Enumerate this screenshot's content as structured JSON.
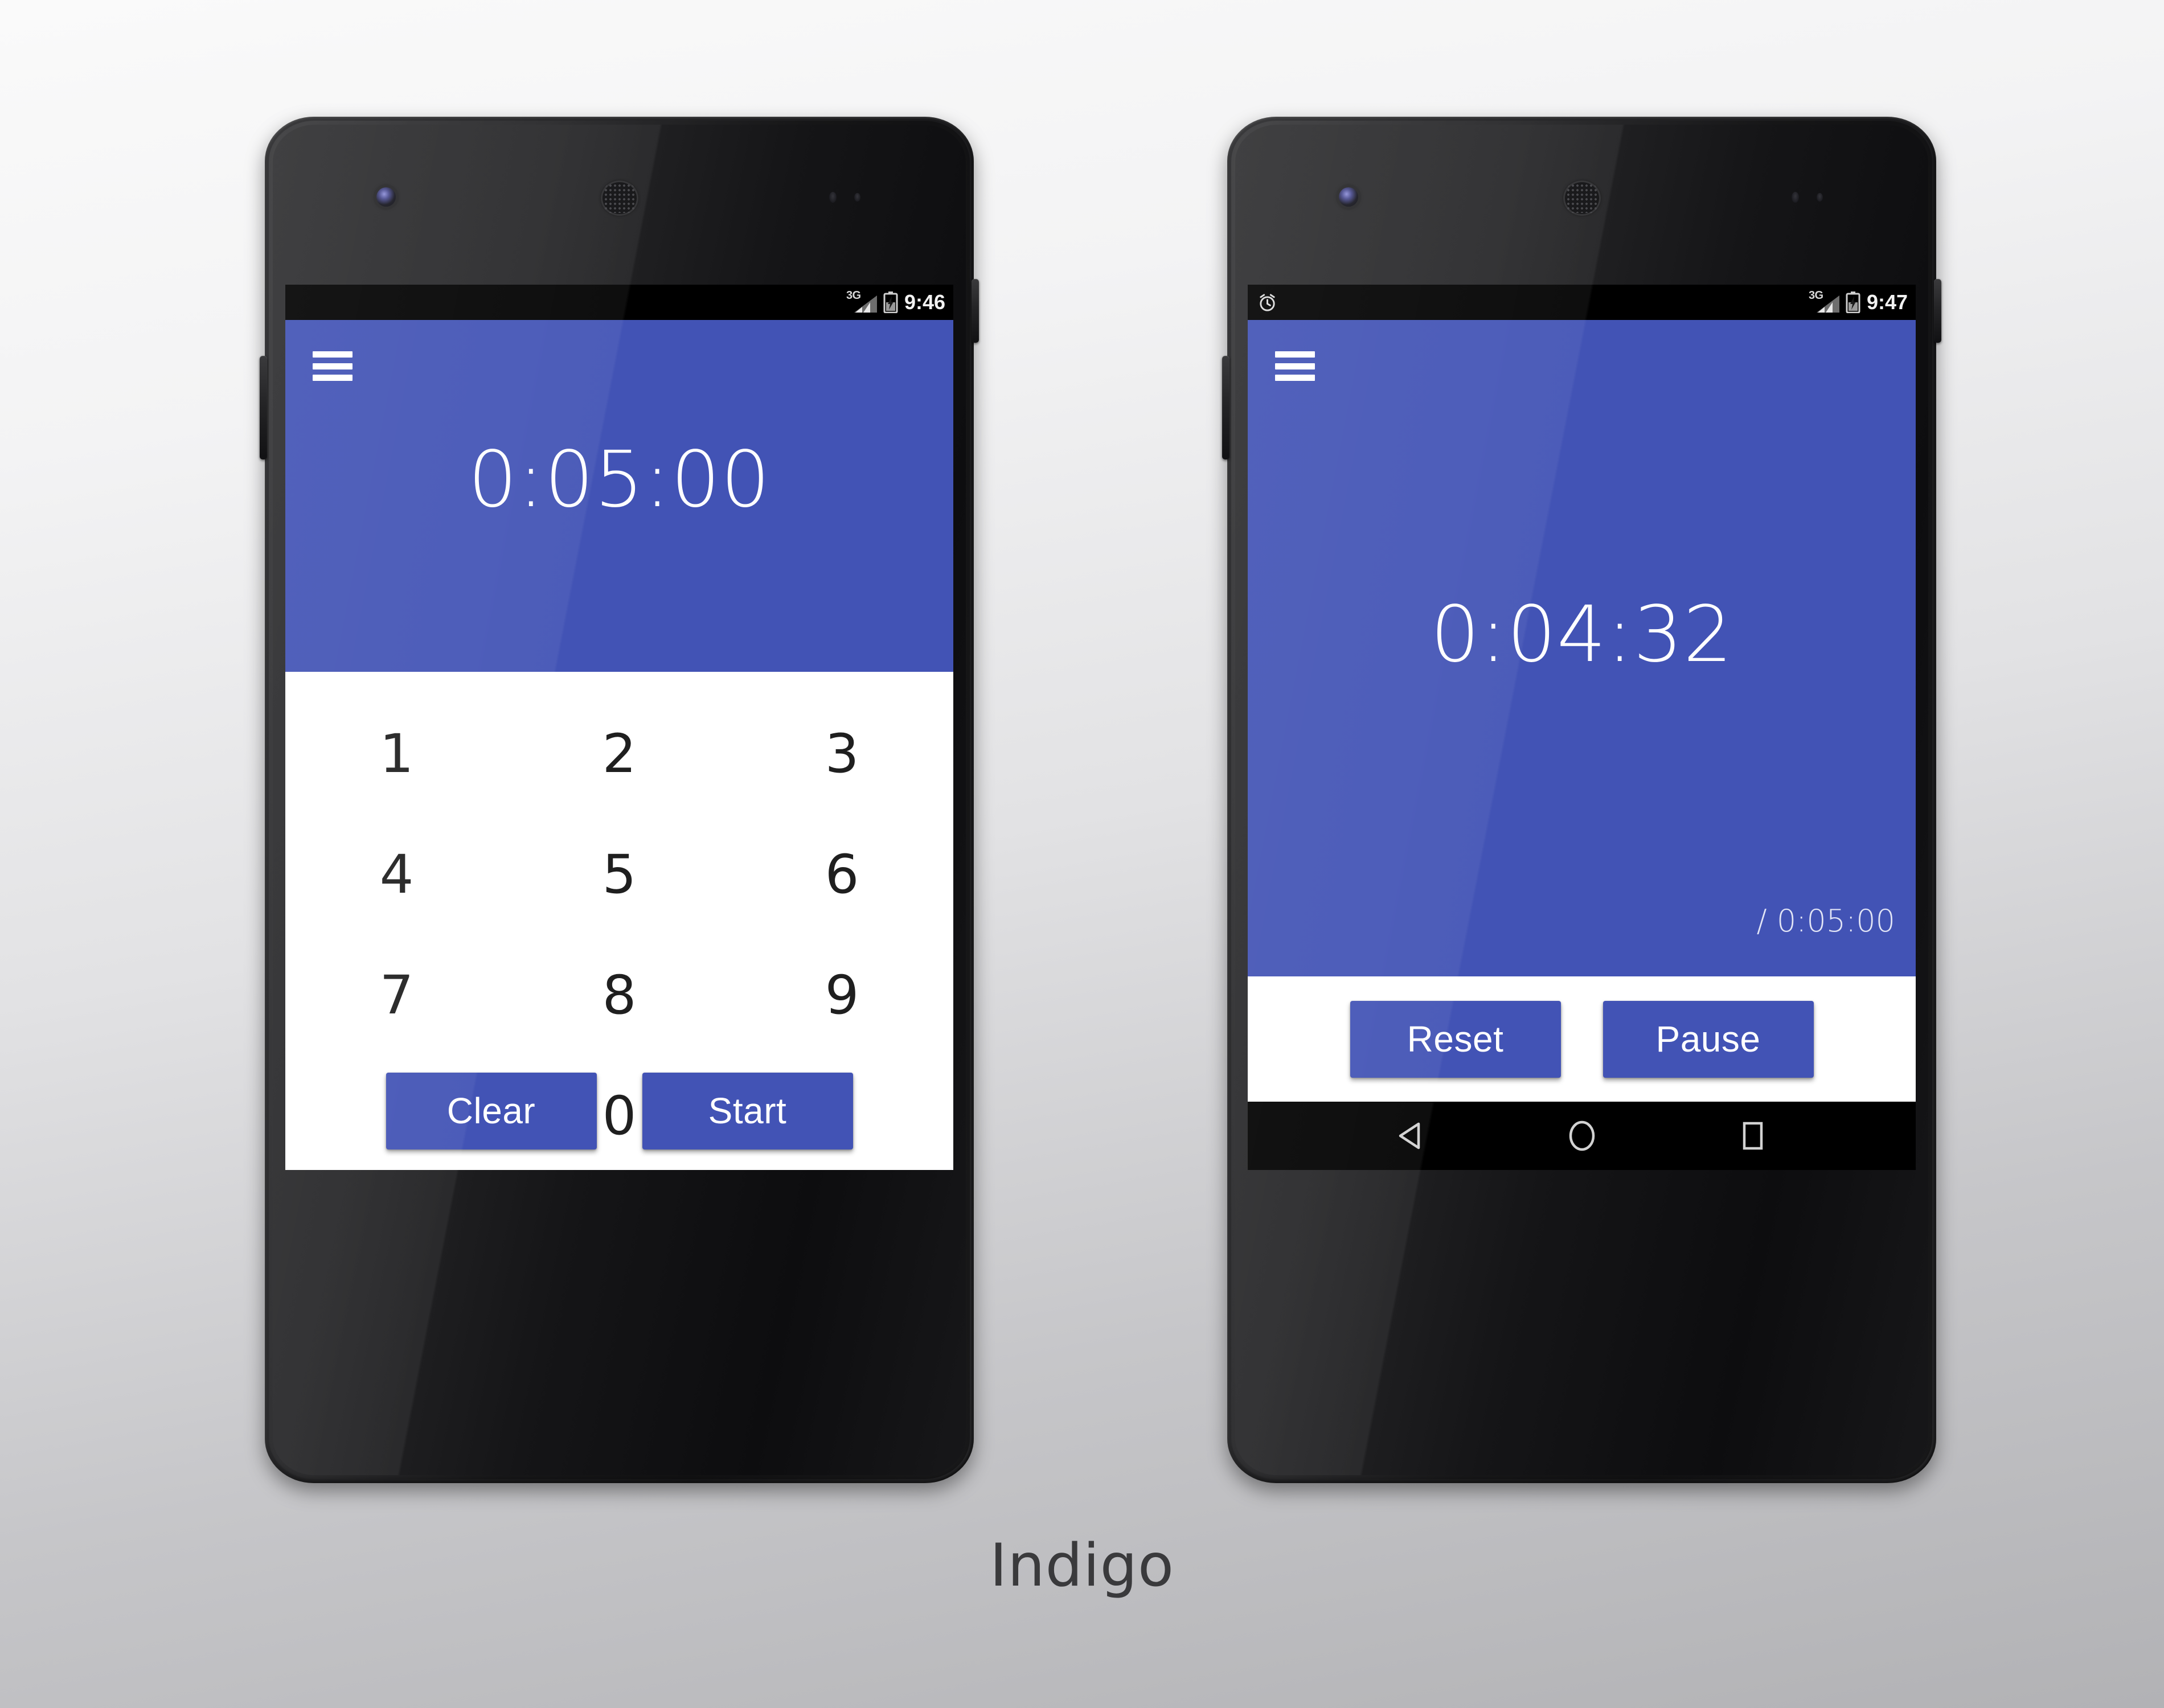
{
  "caption": "Indigo",
  "theme": {
    "primary_color": "#4253b5",
    "screen_bg": "#ffffff",
    "statusbar_bg": "#000000",
    "navbar_bg": "#000000",
    "caption_color": "#3a3a3c"
  },
  "phones": [
    {
      "id": "phone-setup",
      "status_bar": {
        "time": "9:46",
        "network": "3G",
        "icons": [
          "signal-icon",
          "battery-charging-icon"
        ],
        "alarm_visible": false
      },
      "app_bar": {
        "menu_icon": "hamburger-menu-icon",
        "timer_display": "0:05:00"
      },
      "keypad": {
        "rows": [
          [
            "1",
            "2",
            "3"
          ],
          [
            "4",
            "5",
            "6"
          ],
          [
            "7",
            "8",
            "9"
          ]
        ],
        "zero": "0"
      },
      "actions": [
        {
          "label": "Clear",
          "name": "clear-button"
        },
        {
          "label": "Start",
          "name": "start-button"
        }
      ],
      "nav_bar": {
        "back": "back-icon",
        "home": "home-icon",
        "recents": "recents-icon"
      }
    },
    {
      "id": "phone-running",
      "status_bar": {
        "time": "9:47",
        "network": "3G",
        "icons": [
          "alarm-icon",
          "signal-icon",
          "battery-charging-icon"
        ],
        "alarm_visible": true
      },
      "app_bar": {
        "menu_icon": "hamburger-menu-icon"
      },
      "running": {
        "remaining": "0:04:32",
        "total": "/ 0:05:00"
      },
      "actions": [
        {
          "label": "Reset",
          "name": "reset-button"
        },
        {
          "label": "Pause",
          "name": "pause-button"
        }
      ],
      "nav_bar": {
        "back": "back-icon",
        "home": "home-icon",
        "recents": "recents-icon"
      }
    }
  ]
}
